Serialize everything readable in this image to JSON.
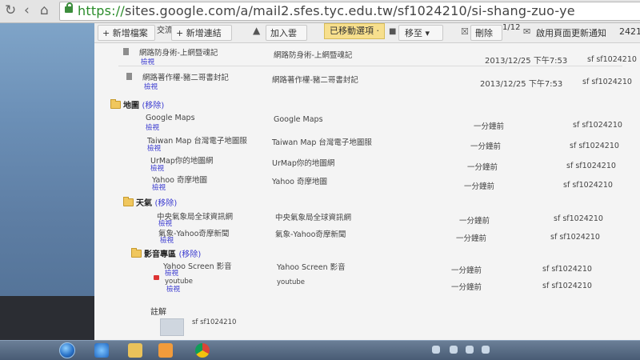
{
  "browser": {
    "url_scheme": "https://",
    "url_rest": "sites.google.com/a/mail2.sfes.tyc.edu.tw/sf1024210/si-shang-zuo-ye"
  },
  "toolbar": {
    "add_file_label": "+ 新增檔案",
    "exchange_label": "交流",
    "add_link_label": "+ 新增連結",
    "add_to_drive_label": "加入雲",
    "moved_notice": "已移動選項 ·",
    "move_to_label": "移至 ▾",
    "delete_label": "刪除",
    "partial_date": "1/12",
    "notify_label": "啟用頁面更新通知",
    "partial_number": "2421"
  },
  "top_files": [
    {
      "name": "網路防身術-上網暨魂記",
      "action": "檢視",
      "description": "網路防身術-上網暨魂記",
      "date": "2013/12/25 下午7:53",
      "owner": "sf sf1024210"
    },
    {
      "name": "網路著作權-豬二哥書封記",
      "action": "檢視",
      "description": "網路著作權-豬二哥書封記",
      "date": "2013/12/25 下午7:53",
      "owner": "sf sf1024210"
    }
  ],
  "sections": [
    {
      "title": "地圖",
      "remove": "(移除)",
      "items": [
        {
          "name": "Google Maps",
          "action": "檢視",
          "description": "Google Maps",
          "time": "一分鐘前",
          "owner": "sf sf1024210"
        },
        {
          "name": "Taiwan Map 台灣電子地圖服",
          "action": "檢視",
          "description": "Taiwan Map 台灣電子地圖服",
          "time": "一分鐘前",
          "owner": "sf sf1024210"
        },
        {
          "name": "UrMap你的地圖網",
          "action": "檢視",
          "description": "UrMap你的地圖網",
          "time": "一分鐘前",
          "owner": "sf sf1024210"
        },
        {
          "name": "Yahoo 奇摩地圖",
          "action": "檢視",
          "description": "Yahoo 奇摩地圖",
          "time": "一分鐘前",
          "owner": "sf sf1024210"
        }
      ]
    },
    {
      "title": "天氣",
      "remove": "(移除)",
      "items": [
        {
          "name": "中央氣象局全球資訊網",
          "action": "檢視",
          "description": "中央氣象局全球資訊網",
          "time": "一分鐘前",
          "owner": "sf sf1024210"
        },
        {
          "name": "氣象-Yahoo奇摩新聞",
          "action": "檢視",
          "description": "氣象-Yahoo奇摩新聞",
          "time": "一分鐘前",
          "owner": "sf sf1024210"
        }
      ]
    },
    {
      "title": "影音專區",
      "remove": "(移除)",
      "items": [
        {
          "name": "Yahoo Screen 影音",
          "action": "檢視",
          "description": "Yahoo Screen 影音",
          "time": "一分鐘前",
          "owner": "sf sf1024210"
        },
        {
          "name": "youtube",
          "action": "檢視",
          "description": "youtube",
          "time": "一分鐘前",
          "owner": "sf sf1024210"
        }
      ]
    }
  ],
  "comments": {
    "heading": "註解",
    "author": "sf sf1024210"
  },
  "colors": {
    "link": "#3b3bd0",
    "moved_notice_bg": "#f7df8d",
    "url_scheme": "#2a8c2a"
  }
}
